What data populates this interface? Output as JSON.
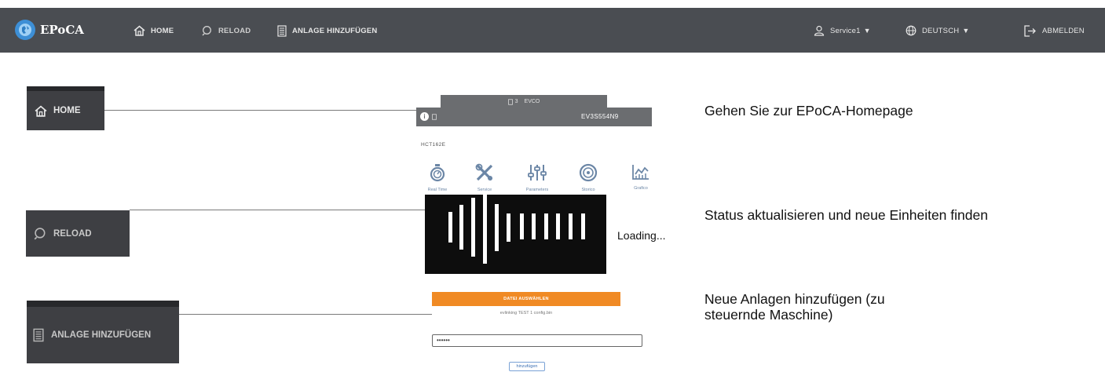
{
  "navbar": {
    "brand": "EPoCA",
    "items": [
      {
        "label": "HOME",
        "icon": "home-icon"
      },
      {
        "label": "RELOAD",
        "icon": "search-icon"
      },
      {
        "label": "ANLAGE HINZUFÜGEN",
        "icon": "building-icon"
      }
    ],
    "user": "Service1",
    "language": "DEUTSCH",
    "logout": "ABMELDEN"
  },
  "callouts": [
    {
      "label": "HOME",
      "icon": "home-icon",
      "description": "Gehen Sie zur EPoCA-Homepage"
    },
    {
      "label": "RELOAD",
      "icon": "search-icon",
      "description": "Status aktualisieren und neue Einheiten finden"
    },
    {
      "label": "ANLAGE HINZUFÜGEN",
      "icon": "building-icon",
      "description": "Neue Anlagen hinzufügen (zu steuernde Maschine)"
    }
  ],
  "device": {
    "tab_count": "3",
    "tab_name": "EVCO",
    "serial": "EV3S554N9",
    "model": "HCT162E",
    "features": [
      "Real Time",
      "Service",
      "Parameters",
      "Storico",
      "Grafico"
    ]
  },
  "loading": {
    "text": "Loading..."
  },
  "upload": {
    "choose_file": "DATEI AUSWÄHLEN",
    "file_name": "evlinking TEST 1 config.bin",
    "password_mask": "••••••",
    "add_button": "hinzufügen"
  },
  "colors": {
    "navbar_bg": "#4a4d52",
    "accent_orange": "#f08a24",
    "feature_icon": "#6b86a6"
  }
}
